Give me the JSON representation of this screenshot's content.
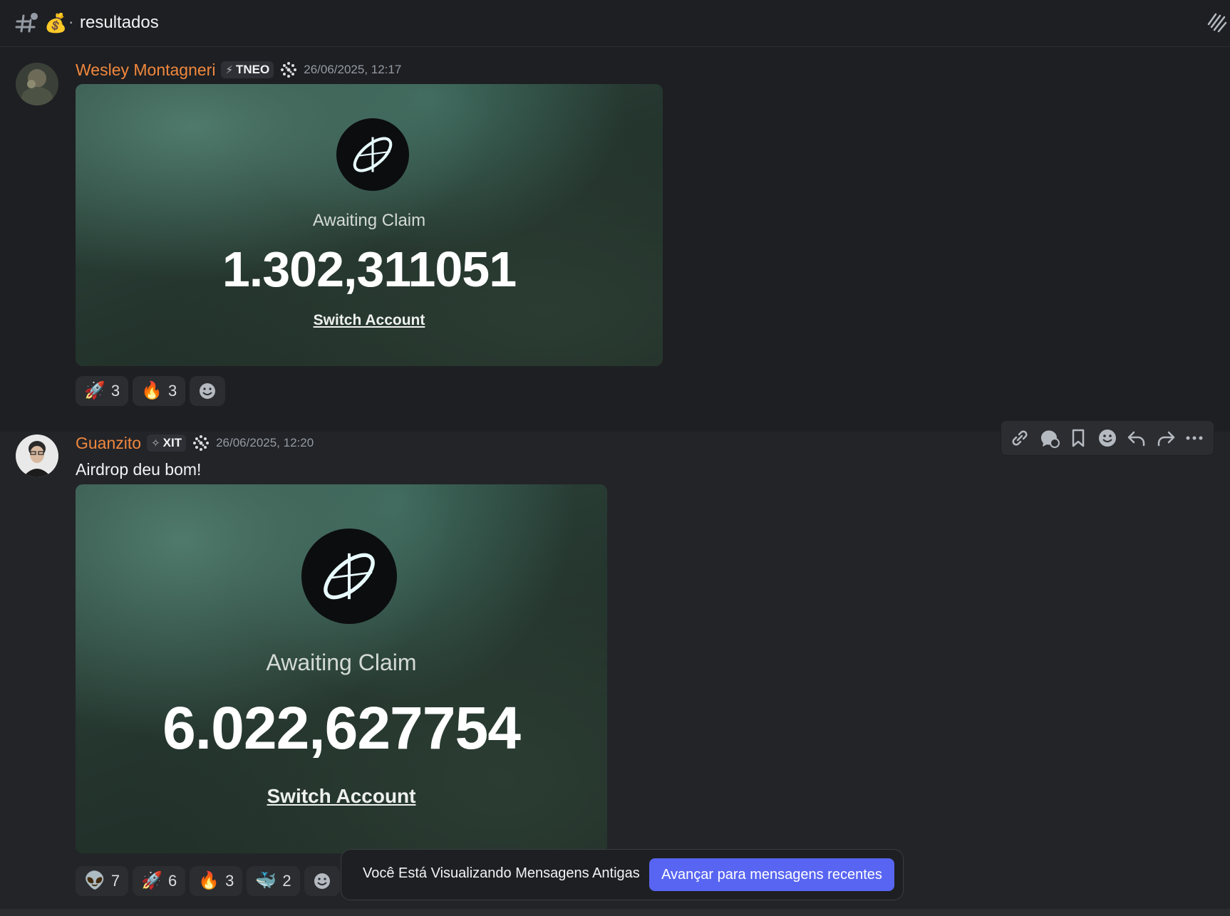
{
  "header": {
    "channel_emoji": "💰",
    "separator": "·",
    "channel_name": "resultados"
  },
  "messages": [
    {
      "username": "Wesley Montagneri",
      "tag": "TNEO",
      "timestamp": "26/06/2025, 12:17",
      "text": "",
      "card": {
        "label": "Awaiting Claim",
        "amount": "1.302,311051",
        "link": "Switch Account"
      },
      "reactions": [
        {
          "emoji": "🚀",
          "count": "3"
        },
        {
          "emoji": "🔥",
          "count": "3"
        }
      ]
    },
    {
      "username": "Guanzito",
      "tag": "XIT",
      "timestamp": "26/06/2025, 12:20",
      "text": "Airdrop deu bom!",
      "card": {
        "label": "Awaiting Claim",
        "amount": "6.022,627754",
        "link": "Switch Account"
      },
      "reactions": [
        {
          "emoji": "👽",
          "count": "7"
        },
        {
          "emoji": "🚀",
          "count": "6"
        },
        {
          "emoji": "🔥",
          "count": "3"
        },
        {
          "emoji": "🐳",
          "count": "2"
        }
      ]
    }
  ],
  "old_messages_bar": {
    "text": "Você Está Visualizando Mensagens Antigas",
    "button": "Avançar para mensagens recentes"
  },
  "colors": {
    "username": "#f0883e",
    "accent": "#5865f2",
    "background": "#1e1f22"
  }
}
